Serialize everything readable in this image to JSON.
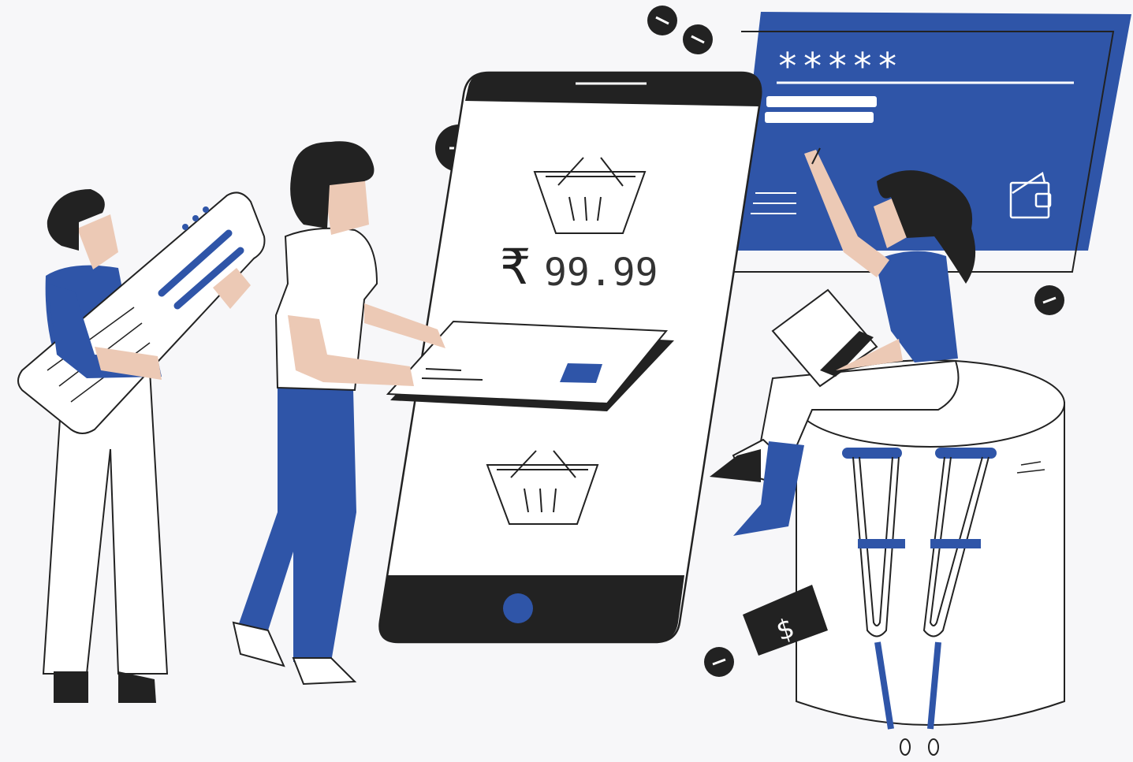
{
  "colors": {
    "blue": "#2f55a8",
    "ink": "#222222",
    "skin": "#ecc9b5",
    "paper": "#ffffff",
    "background": "#f7f7f9"
  },
  "phone": {
    "currency_symbol": "₹",
    "price": "99.99"
  },
  "card": {
    "masked_pin": "*****"
  },
  "banknote": {
    "symbol": "$"
  },
  "icons": [
    "minus-badge-icon",
    "shopping-basket-icon",
    "wallet-icon",
    "home-button-icon",
    "banknote-icon",
    "crutch-icon"
  ]
}
